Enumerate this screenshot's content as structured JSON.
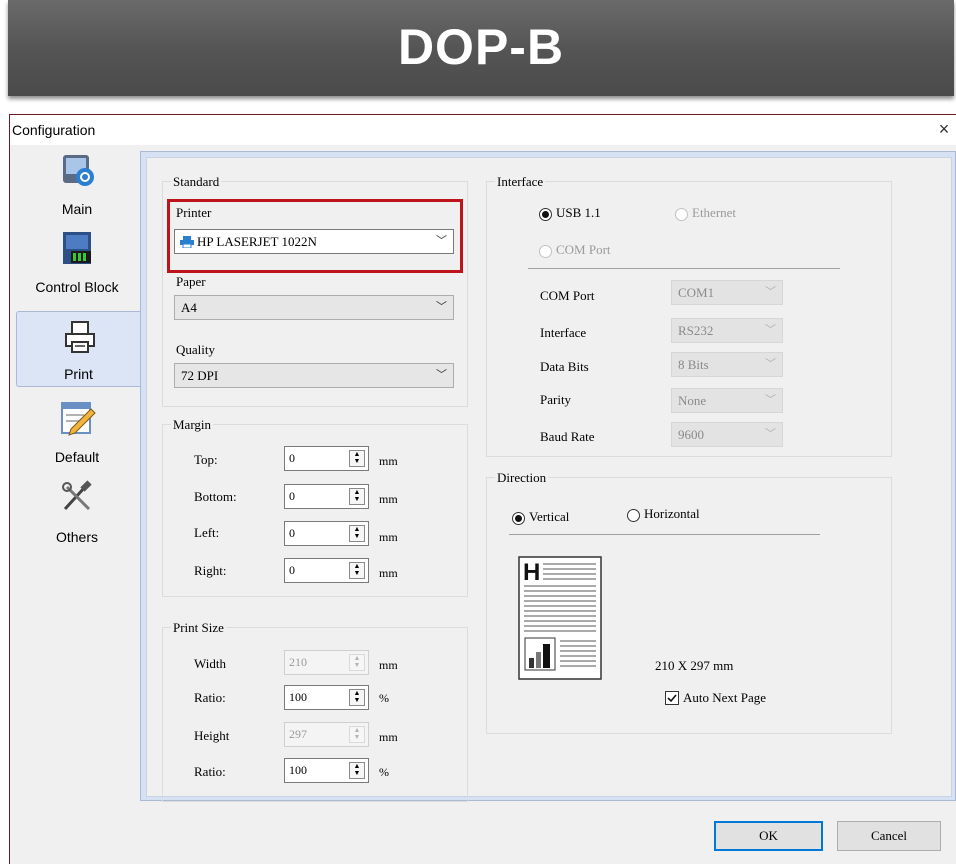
{
  "banner": {
    "title": "DOP-B"
  },
  "window": {
    "title": "Configuration",
    "close_glyph": "×"
  },
  "sidebar": {
    "items": [
      {
        "label": "Main",
        "icon": "main-icon"
      },
      {
        "label": "Control Block",
        "icon": "control-block-icon"
      },
      {
        "label": "Print",
        "icon": "printer-icon",
        "selected": true
      },
      {
        "label": "Default",
        "icon": "default-edit-icon"
      },
      {
        "label": "Others",
        "icon": "tools-icon"
      }
    ]
  },
  "standard": {
    "group_label": "Standard",
    "printer_label": "Printer",
    "printer_value": "HP LASERJET 1022N",
    "paper_label": "Paper",
    "paper_value": "A4",
    "quality_label": "Quality",
    "quality_value": "72 DPI"
  },
  "margin": {
    "group_label": "Margin",
    "rows": [
      {
        "label": "Top:",
        "value": "0",
        "unit": "mm"
      },
      {
        "label": "Bottom:",
        "value": "0",
        "unit": "mm"
      },
      {
        "label": "Left:",
        "value": "0",
        "unit": "mm"
      },
      {
        "label": "Right:",
        "value": "0",
        "unit": "mm"
      }
    ]
  },
  "print_size": {
    "group_label": "Print Size",
    "rows": [
      {
        "label": "Width",
        "value": "210",
        "unit": "mm",
        "disabled": true
      },
      {
        "label": "Ratio:",
        "value": "100",
        "unit": "%",
        "disabled": false
      },
      {
        "label": "Height",
        "value": "297",
        "unit": "mm",
        "disabled": true
      },
      {
        "label": "Ratio:",
        "value": "100",
        "unit": "%",
        "disabled": false
      }
    ]
  },
  "interface": {
    "group_label": "Interface",
    "usb_label": "USB 1.1",
    "ethernet_label": "Ethernet",
    "com_port_radio_label": "COM Port",
    "fields": [
      {
        "label": "COM Port",
        "value": "COM1"
      },
      {
        "label": "Interface",
        "value": "RS232"
      },
      {
        "label": "Data Bits",
        "value": "8 Bits"
      },
      {
        "label": "Parity",
        "value": "None"
      },
      {
        "label": "Baud Rate",
        "value": "9600"
      }
    ]
  },
  "direction": {
    "group_label": "Direction",
    "vertical_label": "Vertical",
    "horizontal_label": "Horizontal",
    "preview_letter": "H",
    "page_size": "210 X 297 mm",
    "auto_next_page_label": "Auto Next Page",
    "auto_next_page_checked": true
  },
  "footer": {
    "ok_label": "OK",
    "cancel_label": "Cancel"
  },
  "colors": {
    "highlight_box": "#c0141c",
    "panel_blue": "#d6e2f3",
    "accent": "#0078d7"
  }
}
